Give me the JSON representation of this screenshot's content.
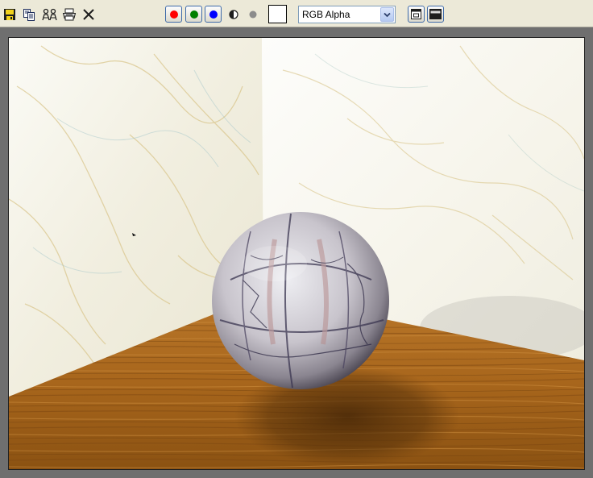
{
  "toolbar": {
    "file_icons": [
      {
        "name": "save-icon",
        "tooltip": ""
      },
      {
        "name": "copy-icon",
        "tooltip": ""
      },
      {
        "name": "clone-icon",
        "tooltip": ""
      },
      {
        "name": "print-icon",
        "tooltip": ""
      },
      {
        "name": "clear-icon",
        "tooltip": ""
      }
    ],
    "channels": [
      {
        "name": "red-channel-button",
        "color": "#ff0000"
      },
      {
        "name": "green-channel-button",
        "color": "#008000"
      },
      {
        "name": "blue-channel-button",
        "color": "#0000ff"
      }
    ],
    "alpha_icon": "monochrome-icon",
    "swatch_color": "#ffffff",
    "channel_select": {
      "value": "RGB Alpha"
    }
  },
  "viewport": {
    "scene": "rendered-sphere-on-wood-floor",
    "colors": {
      "wall": "#f4f2e9",
      "floor_dark": "#7a4a10",
      "floor_light": "#c9852a",
      "frame": "#6f6f6f"
    }
  }
}
